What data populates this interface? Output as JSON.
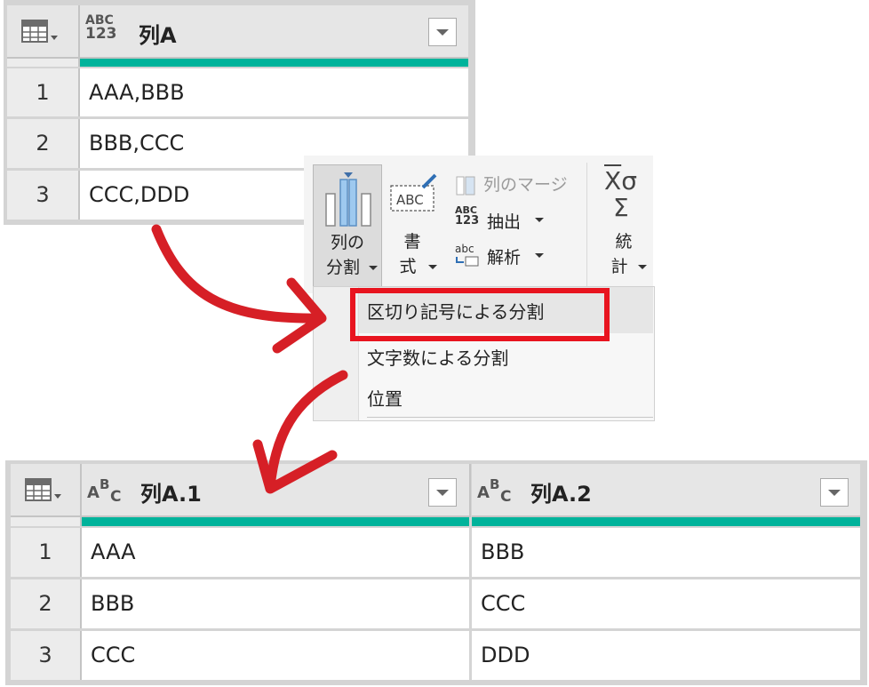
{
  "top_table": {
    "column": {
      "type_top": "ABC",
      "type_bottom": "123",
      "name": "列A"
    },
    "rows": [
      {
        "num": "1",
        "value": "AAA,BBB"
      },
      {
        "num": "2",
        "value": "BBB,CCC"
      },
      {
        "num": "3",
        "value": "CCC,DDD"
      }
    ]
  },
  "ribbon": {
    "split_column": {
      "line1": "列の",
      "line2": "分割"
    },
    "format": {
      "icon_text": "ABC",
      "line1": "書",
      "line2": "式"
    },
    "merge_columns": "列のマージ",
    "extract": {
      "icon_top": "ABC",
      "icon_bottom": "123",
      "label": "抽出"
    },
    "parse": {
      "icon_text": "abc",
      "label": "解析"
    },
    "statistics": {
      "icon_text": "XΣ",
      "line1": "統",
      "line2": "計"
    }
  },
  "menu": {
    "items": [
      {
        "label": "区切り記号による分割",
        "highlighted": true
      },
      {
        "label": "文字数による分割",
        "highlighted": false
      },
      {
        "label": "位置",
        "highlighted": false
      }
    ]
  },
  "bottom_table": {
    "columns": [
      {
        "type_icon": "ABC",
        "name": "列A.1"
      },
      {
        "type_icon": "ABC",
        "name": "列A.2"
      }
    ],
    "rows": [
      {
        "num": "1",
        "c1": "AAA",
        "c2": "BBB"
      },
      {
        "num": "2",
        "c1": "BBB",
        "c2": "CCC"
      },
      {
        "num": "3",
        "c1": "CCC",
        "c2": "DDD"
      }
    ]
  },
  "colors": {
    "accent_teal": "#00b39b",
    "highlight_red": "#e8141f",
    "arrow_red": "#d61f26"
  }
}
